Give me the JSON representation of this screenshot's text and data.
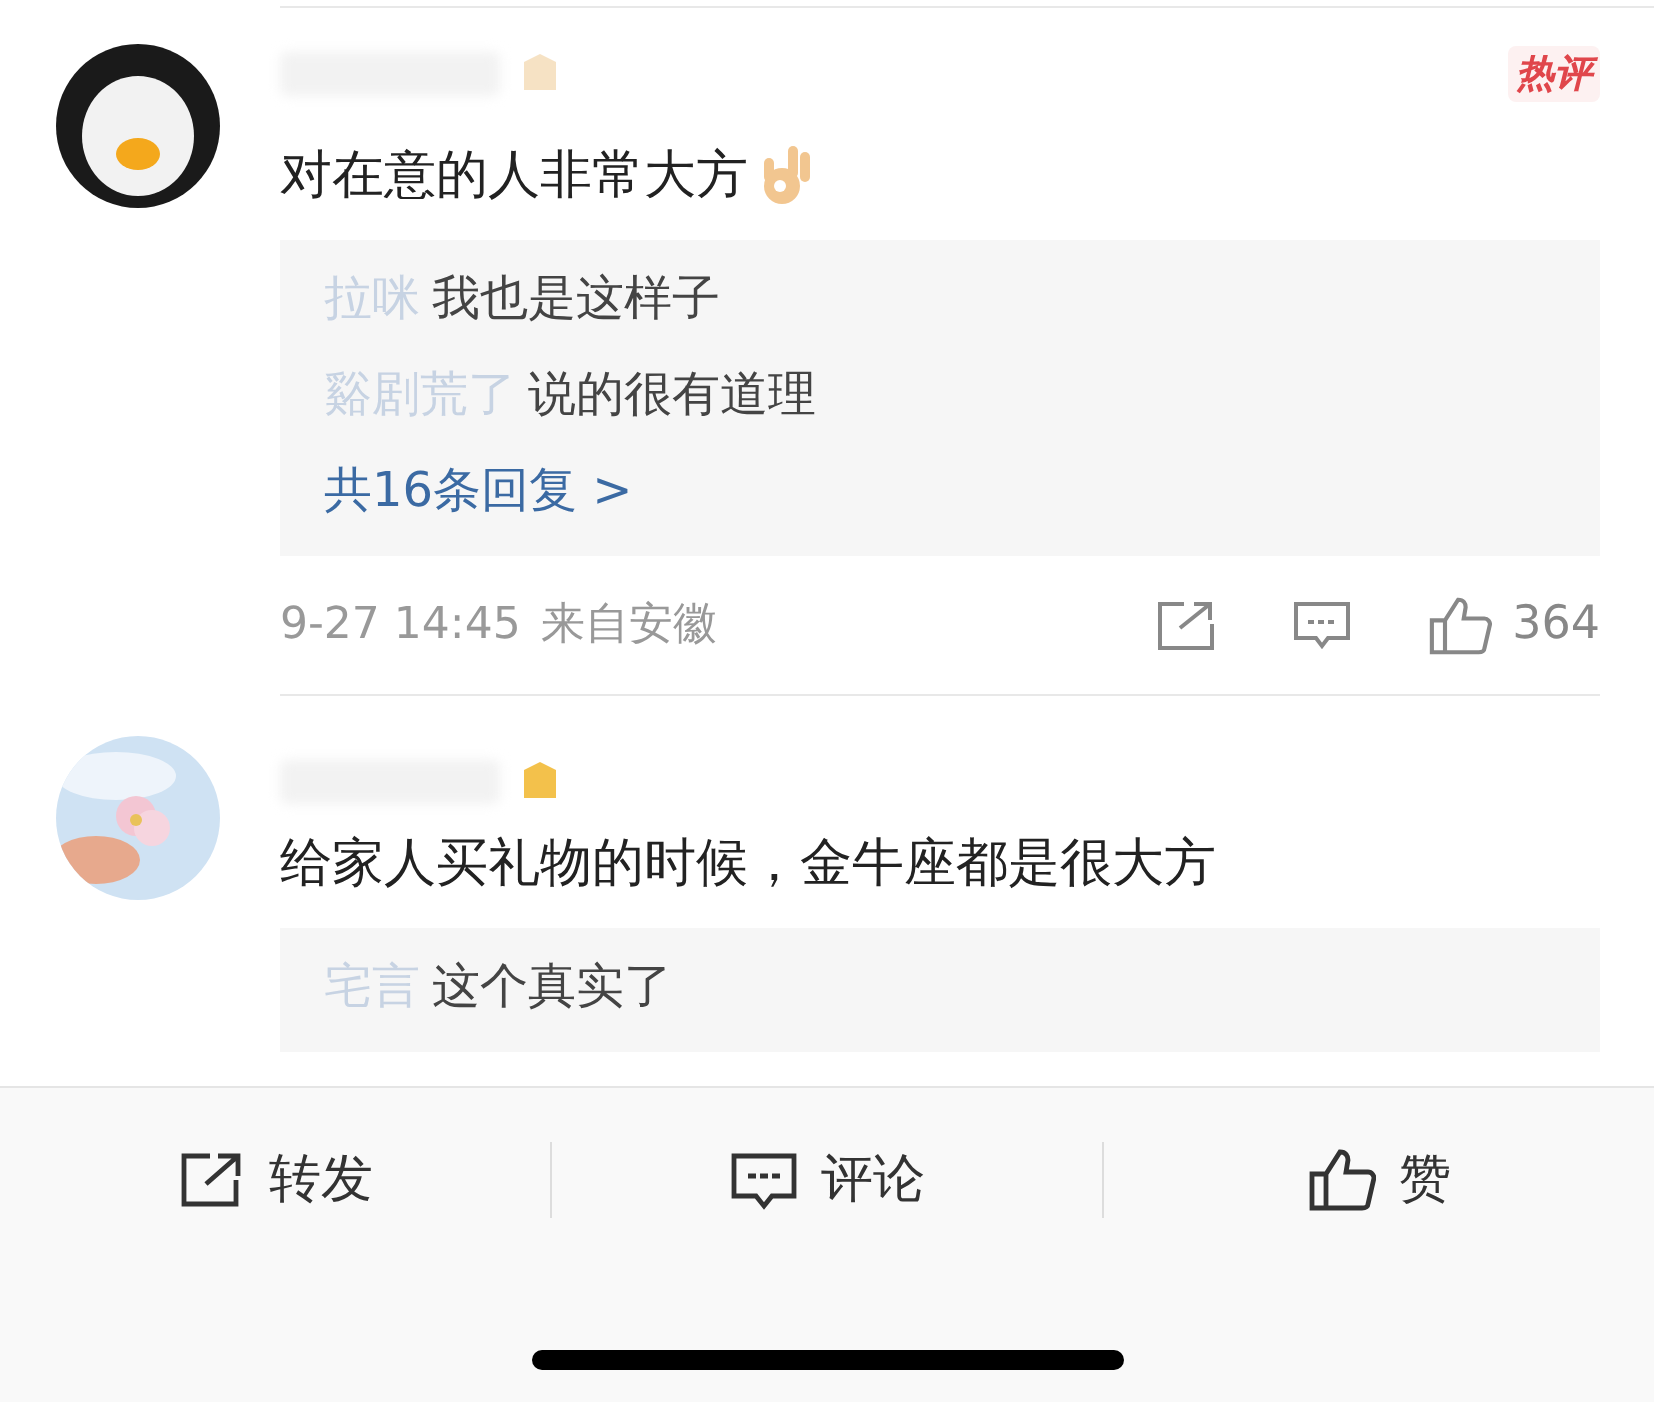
{
  "comments": [
    {
      "hot_label": "热评",
      "text": "对在意的人非常大方",
      "avatar": {
        "kind": "egg"
      },
      "replies": [
        {
          "name": "拉咪",
          "text": "我也是这样子"
        },
        {
          "name": "谿剧荒了",
          "text": "说的很有道理"
        }
      ],
      "more_replies": "共16条回复 >",
      "time": "9-27 14:45",
      "source": "来自安徽",
      "likes": "364"
    },
    {
      "text": "给家人买礼物的时候，金牛座都是很大方",
      "avatar": {
        "kind": "flower"
      },
      "replies": [
        {
          "name": "宅言",
          "text": "这个真实了"
        }
      ]
    }
  ],
  "bottom_bar": [
    {
      "kind": "repost",
      "label": "转发"
    },
    {
      "kind": "comment",
      "label": "评论"
    },
    {
      "kind": "like",
      "label": "赞"
    }
  ]
}
